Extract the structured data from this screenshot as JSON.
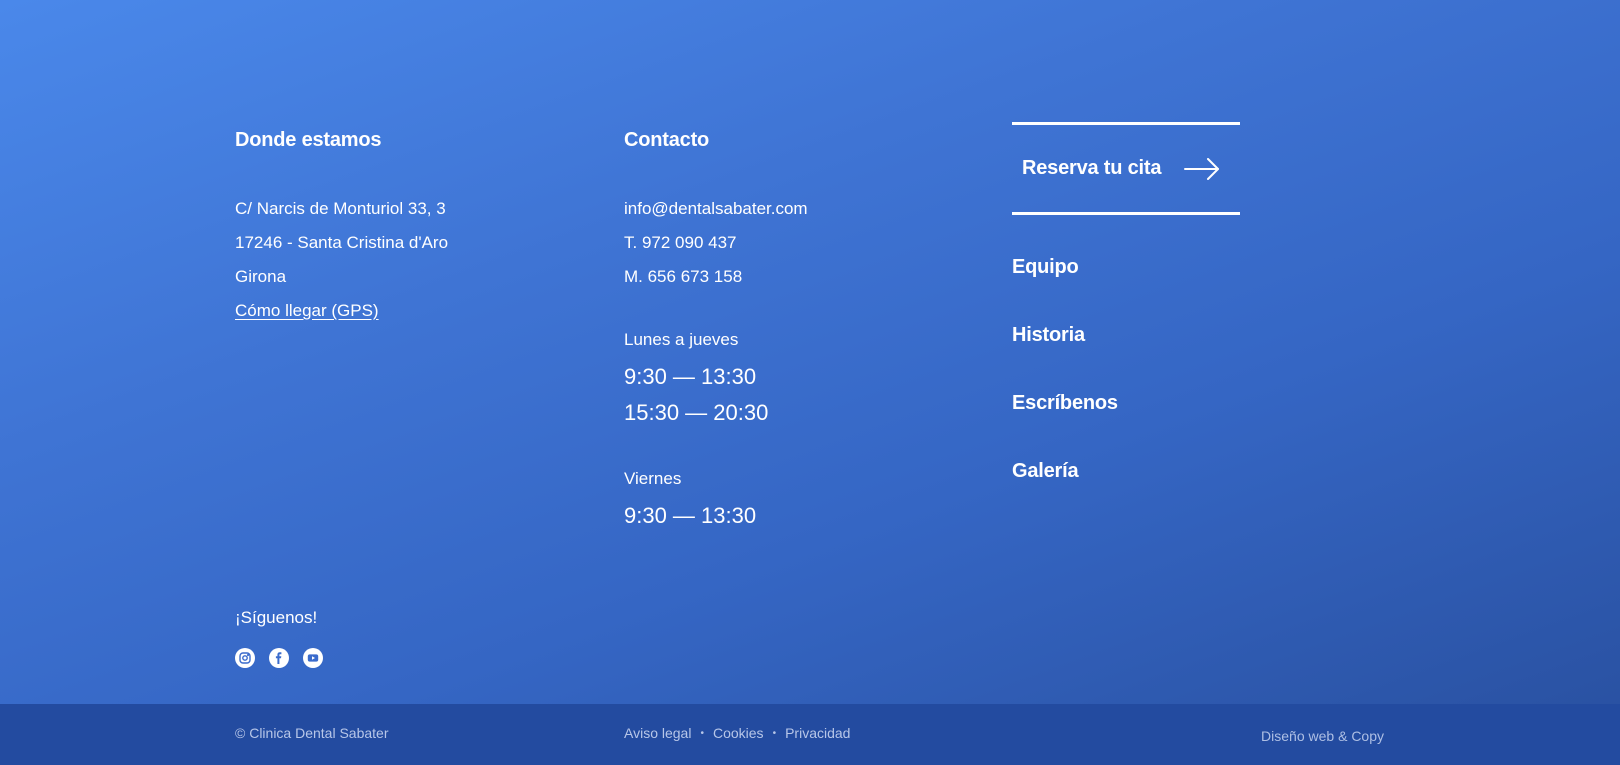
{
  "where": {
    "heading": "Donde estamos",
    "address_line1": "C/ Narcis de Monturiol 33, 3",
    "address_line2": "17246 - Santa Cristina d'Aro",
    "address_line3": "Girona",
    "gps_link": "Cómo llegar (GPS)"
  },
  "contact": {
    "heading": "Contacto",
    "email": "info@dentalsabater.com",
    "phone": "T. 972 090 437",
    "mobile": "M. 656 673 158",
    "hours": [
      {
        "label": "Lunes a jueves",
        "times": [
          "9:30 — 13:30",
          "15:30 — 20:30"
        ]
      },
      {
        "label": "Viernes",
        "times": [
          "9:30 — 13:30"
        ]
      }
    ]
  },
  "nav": {
    "reserve_label": "Reserva tu cita",
    "items": [
      "Equipo",
      "Historia",
      "Escríbenos",
      "Galería"
    ]
  },
  "social": {
    "label": "¡Síguenos!",
    "icons": [
      "instagram-icon",
      "facebook-icon",
      "youtube-icon"
    ]
  },
  "footer": {
    "copyright": "© Clinica Dental Sabater",
    "legal_links": [
      "Aviso legal",
      "Cookies",
      "Privacidad"
    ],
    "separator": "•",
    "credits": "Diseño web & Copy"
  },
  "colors": {
    "gradient_start": "#4a88ea",
    "gradient_end": "#2a52a3",
    "bottom_bar": "#234ba0",
    "muted_text": "#b7c6e8"
  }
}
